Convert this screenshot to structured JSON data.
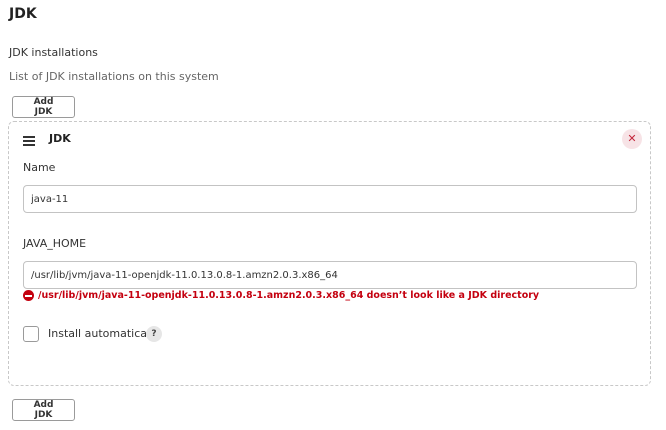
{
  "section": {
    "title": "JDK",
    "field_label": "JDK installations",
    "description": "List of JDK installations on this system"
  },
  "add_button_label": "Add JDK",
  "jdk_card": {
    "title": "JDK",
    "close_symbol": "✕",
    "name_label": "Name",
    "name_value": "java-11",
    "java_home_label": "JAVA_HOME",
    "java_home_value": "/usr/lib/jvm/java-11-openjdk-11.0.13.0.8-1.amzn2.0.3.x86_64",
    "error_message": "/usr/lib/jvm/java-11-openjdk-11.0.13.0.8-1.amzn2.0.3.x86_64 doesn’t look like a JDK directory",
    "install_auto_label": "Install automatically",
    "install_auto_checked": false,
    "help_symbol": "?"
  },
  "icons": {
    "drag_handle": "drag-handle-icon",
    "close": "close-icon",
    "error": "error-icon",
    "help": "help-icon"
  },
  "colors": {
    "error": "#c4000f",
    "close_bg": "#f7e3e6",
    "close_fg": "#c4283c",
    "border": "#c3c3c3"
  }
}
